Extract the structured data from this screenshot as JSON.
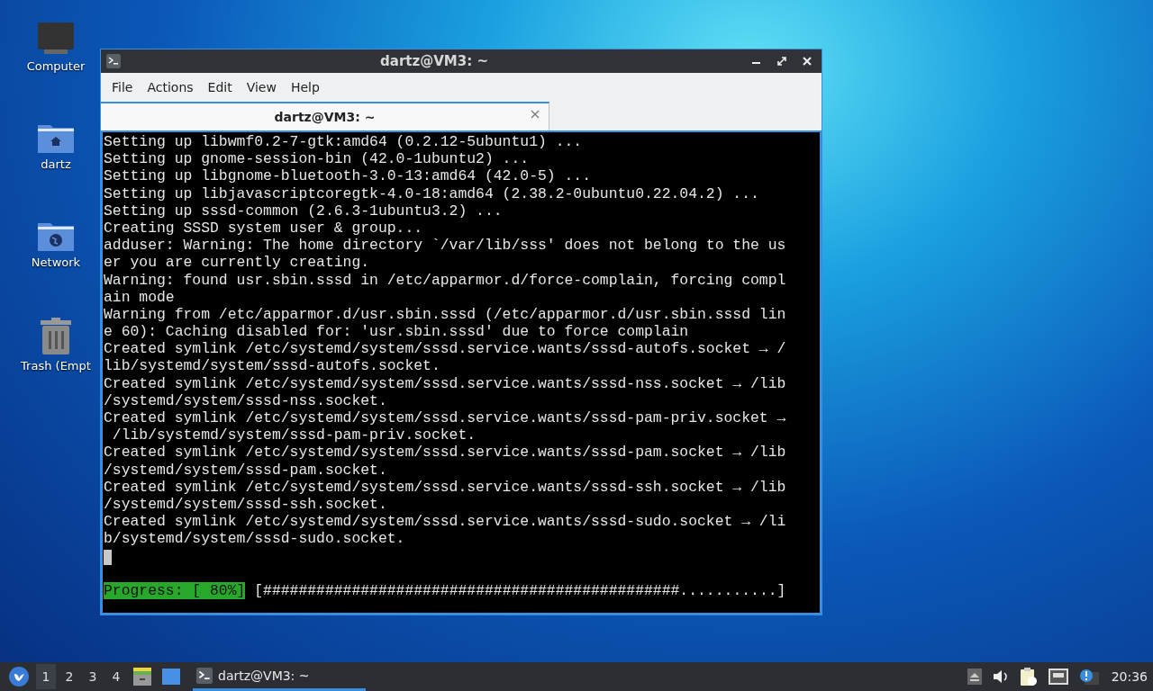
{
  "desktop_icons": [
    {
      "kind": "computer",
      "label": "Computer"
    },
    {
      "kind": "home",
      "label": "dartz"
    },
    {
      "kind": "network",
      "label": "Network"
    },
    {
      "kind": "trash",
      "label": "Trash (Empt"
    }
  ],
  "window": {
    "title": "dartz@VM3: ~",
    "menu": [
      "File",
      "Actions",
      "Edit",
      "View",
      "Help"
    ],
    "tabs": [
      {
        "label": "dartz@VM3: ~",
        "selected": true
      }
    ],
    "terminal_lines": [
      {
        "kind": "text",
        "text": "Setting up libwmf0.2-7-gtk:amd64 (0.2.12-5ubuntu1) ..."
      },
      {
        "kind": "text",
        "text": "Setting up gnome-session-bin (42.0-1ubuntu2) ..."
      },
      {
        "kind": "text",
        "text": "Setting up libgnome-bluetooth-3.0-13:amd64 (42.0-5) ..."
      },
      {
        "kind": "text",
        "text": "Setting up libjavascriptcoregtk-4.0-18:amd64 (2.38.2-0ubuntu0.22.04.2) ..."
      },
      {
        "kind": "text",
        "text": "Setting up sssd-common (2.6.3-1ubuntu3.2) ..."
      },
      {
        "kind": "text",
        "text": "Creating SSSD system user & group..."
      },
      {
        "kind": "text",
        "text": "adduser: Warning: The home directory `/var/lib/sss' does not belong to the us"
      },
      {
        "kind": "text",
        "text": "er you are currently creating."
      },
      {
        "kind": "text",
        "text": "Warning: found usr.sbin.sssd in /etc/apparmor.d/force-complain, forcing compl"
      },
      {
        "kind": "text",
        "text": "ain mode"
      },
      {
        "kind": "text",
        "text": "Warning from /etc/apparmor.d/usr.sbin.sssd (/etc/apparmor.d/usr.sbin.sssd lin"
      },
      {
        "kind": "text",
        "text": "e 60): Caching disabled for: 'usr.sbin.sssd' due to force complain"
      },
      {
        "kind": "text",
        "text": "Created symlink /etc/systemd/system/sssd.service.wants/sssd-autofs.socket → /"
      },
      {
        "kind": "text",
        "text": "lib/systemd/system/sssd-autofs.socket."
      },
      {
        "kind": "text",
        "text": "Created symlink /etc/systemd/system/sssd.service.wants/sssd-nss.socket → /lib"
      },
      {
        "kind": "text",
        "text": "/systemd/system/sssd-nss.socket."
      },
      {
        "kind": "text",
        "text": "Created symlink /etc/systemd/system/sssd.service.wants/sssd-pam-priv.socket →"
      },
      {
        "kind": "text",
        "text": " /lib/systemd/system/sssd-pam-priv.socket."
      },
      {
        "kind": "text",
        "text": "Created symlink /etc/systemd/system/sssd.service.wants/sssd-pam.socket → /lib"
      },
      {
        "kind": "text",
        "text": "/systemd/system/sssd-pam.socket."
      },
      {
        "kind": "text",
        "text": "Created symlink /etc/systemd/system/sssd.service.wants/sssd-ssh.socket → /lib"
      },
      {
        "kind": "text",
        "text": "/systemd/system/sssd-ssh.socket."
      },
      {
        "kind": "text",
        "text": "Created symlink /etc/systemd/system/sssd.service.wants/sssd-sudo.socket → /li"
      },
      {
        "kind": "text",
        "text": "b/systemd/system/sssd-sudo.socket."
      },
      {
        "kind": "cursor"
      },
      {
        "kind": "blank"
      },
      {
        "kind": "progress",
        "label": "Progress: [ 80%]",
        "bar": "[###############################################...........]"
      }
    ]
  },
  "taskbar": {
    "workspaces": [
      {
        "label": "1",
        "selected": true
      },
      {
        "label": "2",
        "selected": false
      },
      {
        "label": "3",
        "selected": false
      },
      {
        "label": "4",
        "selected": false
      }
    ],
    "tasks": [
      {
        "label": "dartz@VM3: ~",
        "selected": true
      }
    ],
    "clock": "20:36"
  }
}
